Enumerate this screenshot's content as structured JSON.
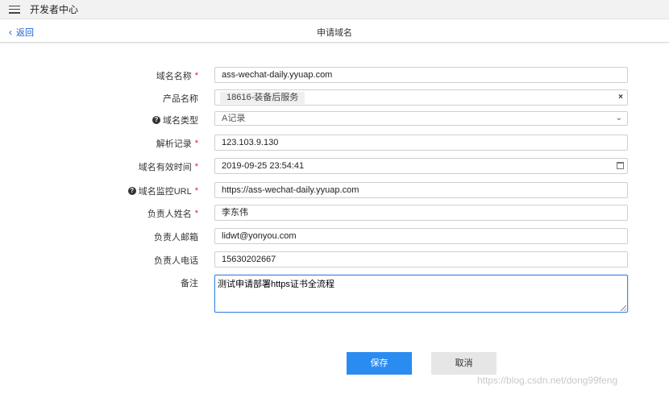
{
  "app": {
    "title": "开发者中心",
    "menu_icon": "hamburger-menu-icon"
  },
  "header": {
    "back_label": "返回",
    "page_title": "申请域名"
  },
  "form": {
    "domain_name": {
      "label": "域名名称",
      "required": "*",
      "value": "ass-wechat-daily.yyuap.com"
    },
    "product_name": {
      "label": "产品名称",
      "tag": "18616-装备后服务",
      "clear": "×"
    },
    "domain_type": {
      "label": "域名类型",
      "help": "?",
      "value": "A记录"
    },
    "resolve_record": {
      "label": "解析记录",
      "required": "*",
      "value": "123.103.9.130"
    },
    "valid_time": {
      "label": "域名有效时间",
      "required": "*",
      "value": "2019-09-25 23:54:41"
    },
    "monitor_url": {
      "label": "域名监控URL",
      "required": "*",
      "help": "?",
      "value": "https://ass-wechat-daily.yyuap.com"
    },
    "owner_name": {
      "label": "负责人姓名",
      "required": "*",
      "value": "李东伟"
    },
    "owner_email": {
      "label": "负责人邮箱",
      "value": "lidwt@yonyou.com"
    },
    "owner_phone": {
      "label": "负责人电话",
      "value": "15630202667"
    },
    "remark": {
      "label": "备注",
      "value": "测试申请部署https证书全流程"
    }
  },
  "buttons": {
    "save": "保存",
    "cancel": "取消"
  },
  "watermark": "https://blog.csdn.net/dong99feng"
}
